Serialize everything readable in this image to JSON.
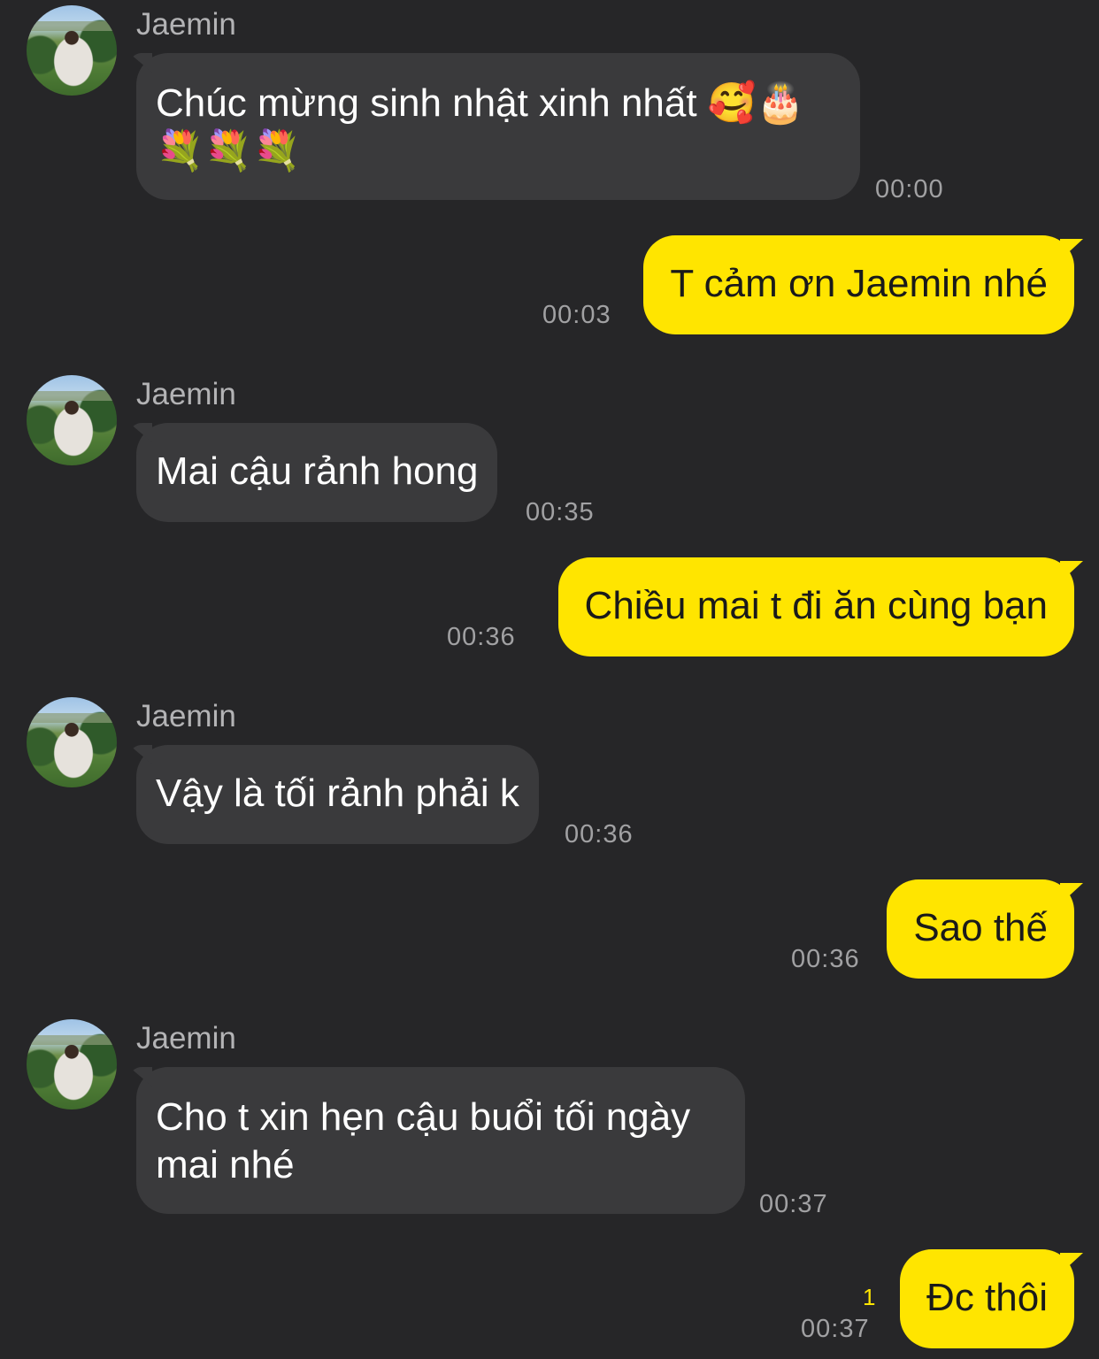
{
  "colors": {
    "background": "#262628",
    "incoming_bubble": "#3a3a3c",
    "outgoing_bubble": "#ffe500",
    "sender_name": "#b3b3b5",
    "timestamp": "#a1a1a3",
    "unread_count": "#ffe500"
  },
  "messages": [
    {
      "direction": "incoming",
      "sender": "Jaemin",
      "text": "Chúc mừng sinh nhật xinh nhất 🥰🎂\n💐💐💐",
      "time": "00:00"
    },
    {
      "direction": "outgoing",
      "text": "T cảm ơn Jaemin nhé",
      "time": "00:03"
    },
    {
      "direction": "incoming",
      "sender": "Jaemin",
      "text": "Mai cậu rảnh hong",
      "time": "00:35"
    },
    {
      "direction": "outgoing",
      "text": "Chiều mai t đi ăn cùng bạn",
      "time": "00:36"
    },
    {
      "direction": "incoming",
      "sender": "Jaemin",
      "text": "Vậy là tối rảnh phải k",
      "time": "00:36"
    },
    {
      "direction": "outgoing",
      "text": "Sao thế",
      "time": "00:36"
    },
    {
      "direction": "incoming",
      "sender": "Jaemin",
      "text": "Cho t xin hẹn cậu buổi tối ngày\nmai nhé",
      "time": "00:37"
    },
    {
      "direction": "outgoing",
      "text": "Đc thôi",
      "time": "00:37",
      "unread": "1"
    }
  ]
}
